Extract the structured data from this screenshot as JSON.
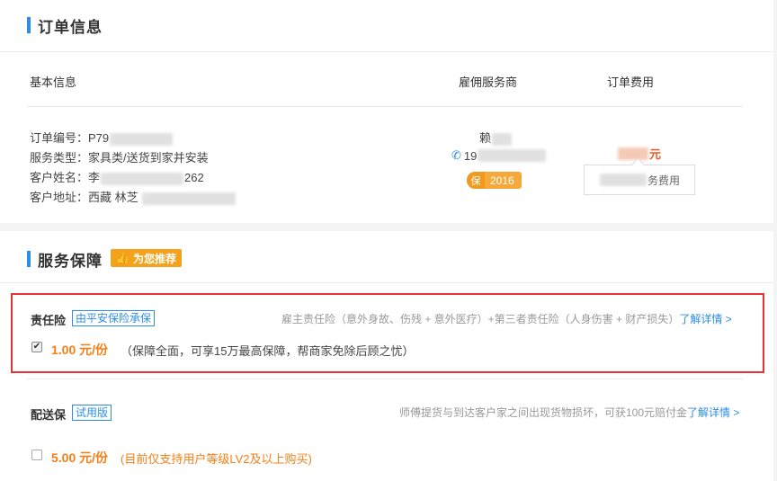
{
  "order_section": {
    "title": "订单信息",
    "columns": {
      "basic": "基本信息",
      "provider": "雇佣服务商",
      "fee": "订单费用"
    },
    "order_number_label": "订单编号：",
    "order_number_prefix": "P79",
    "service_type_label": "服务类型：",
    "service_type_value": "家具类/送货到家并安装",
    "customer_name_label": "客户姓名：",
    "customer_name_prefix": "李",
    "customer_name_suffix": "262",
    "customer_address_label": "客户地址：",
    "customer_address_value": "西藏 林芝",
    "provider_name_prefix": "赖",
    "provider_phone_prefix": "19",
    "guarantee_badge": "保",
    "guarantee_year": "2016",
    "price_suffix": "元",
    "fee_popup_suffix": "务费用"
  },
  "service_section": {
    "title": "服务保障",
    "recommend_badge": "为您推荐",
    "liability": {
      "name": "责任险",
      "tag": "由平安保险承保",
      "description": "雇主责任险（意外身故、伤残 + 意外医疗）+第三者责任险（人身伤害 + 财产损失）",
      "detail_link": "了解详情 >",
      "checked": true,
      "price": "1.00 元/份",
      "note": "（保障全面，可享15万最高保障，帮商家免除后顾之忧）"
    },
    "delivery": {
      "name": "配送保",
      "tag": "试用版",
      "description": "师傅提货与到达客户家之间出现货物损坏，可获100元赔付金",
      "detail_link": "了解详情 >",
      "checked": false,
      "price": "5.00 元/份",
      "note": "(目前仅支持用户等级LV2及以上购买)"
    }
  },
  "colors": {
    "accent_blue": "#2b8de6",
    "price_orange": "#f57f17",
    "highlight_red": "#e53333",
    "badge_orange": "#f4a21c"
  }
}
